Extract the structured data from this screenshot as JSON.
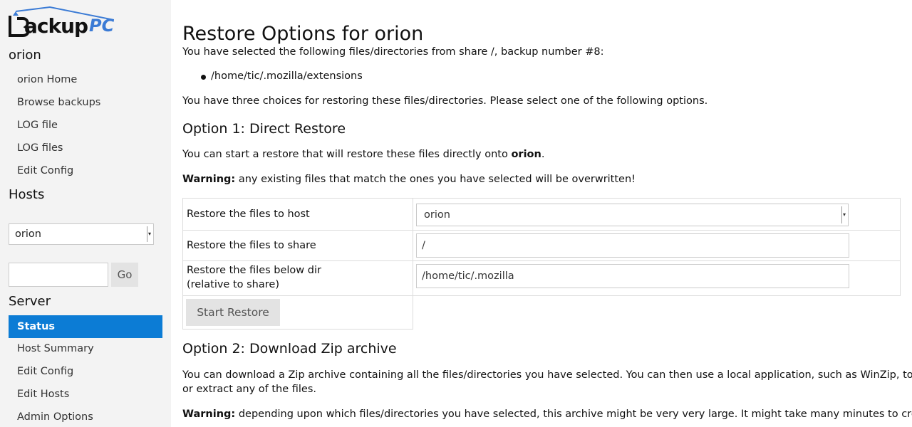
{
  "logo": {
    "text": "BackupPC",
    "word": "ackup",
    "pc": "PC"
  },
  "sidebar": {
    "host_heading": "orion",
    "host_links": [
      "orion Home",
      "Browse backups",
      "LOG file",
      "LOG files",
      "Edit Config"
    ],
    "hosts_heading": "Hosts",
    "host_select_value": "orion",
    "search_placeholder": "",
    "go_label": "Go",
    "server_heading": "Server",
    "server_links": [
      "Status",
      "Host Summary",
      "Edit Config",
      "Edit Hosts",
      "Admin Options"
    ],
    "active_link": "Status"
  },
  "main": {
    "title": "Restore Options for orion",
    "selected_intro": "You have selected the following files/directories from share /, backup number #8:",
    "selected_files": [
      "/home/tic/.mozilla/extensions"
    ],
    "choices_text": "You have three choices for restoring these files/directories. Please select one of the following options.",
    "option1": {
      "heading": "Option 1: Direct Restore",
      "text_prefix": "You can start a restore that will restore these files directly onto ",
      "text_host": "orion",
      "text_suffix": ".",
      "warning_label": "Warning:",
      "warning_text": " any existing files that match the ones you have selected will be overwritten!",
      "rows": {
        "host_label": "Restore the files to host",
        "host_value": "orion",
        "share_label": "Restore the files to share",
        "share_value": "/",
        "dir_label_line1": "Restore the files below dir",
        "dir_label_line2": "(relative to share)",
        "dir_value": "/home/tic/.mozilla"
      },
      "start_button": "Start Restore"
    },
    "option2": {
      "heading": "Option 2: Download Zip archive",
      "text_line1": "You can download a Zip archive containing all the files/directories you have selected. You can then use a local application, such as WinZip, to view",
      "text_line2": "or extract any of the files.",
      "warning_label": "Warning:",
      "warning_text": " depending upon which files/directories you have selected, this archive might be very very large. It might take many minutes to create"
    }
  },
  "colors": {
    "accent": "#0c7cd5",
    "logo_pc": "#3b7bd5",
    "sidebar_bg": "#f3f3f3"
  }
}
